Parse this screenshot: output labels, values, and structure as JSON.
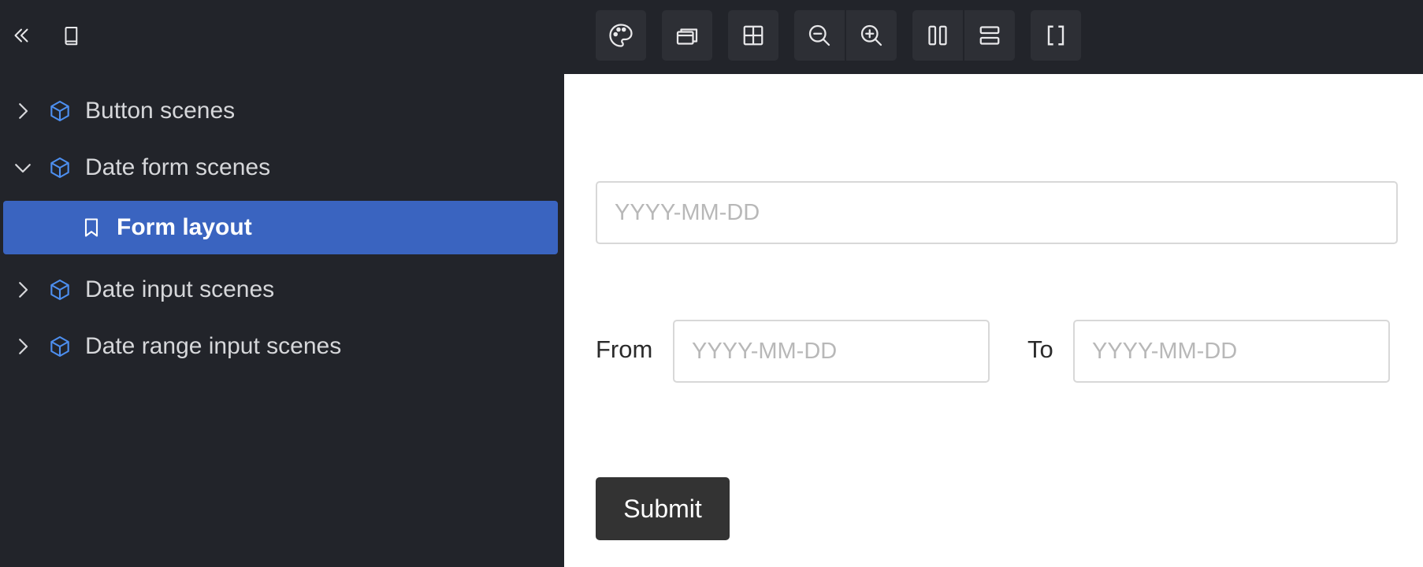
{
  "header": {
    "collapse_icon": "double-chevron-left-icon",
    "book_icon": "book-icon",
    "toolbar": [
      {
        "name": "palette-icon"
      },
      {
        "name": "layers-icon"
      },
      {
        "name": "grid-icon"
      },
      {
        "name": "zoom-out-icon"
      },
      {
        "name": "zoom-in-icon"
      },
      {
        "name": "split-vertical-icon"
      },
      {
        "name": "split-horizontal-icon"
      },
      {
        "name": "brackets-icon"
      }
    ]
  },
  "sidebar": {
    "items": [
      {
        "label": "Button scenes",
        "expanded": false
      },
      {
        "label": "Date form scenes",
        "expanded": true
      },
      {
        "label": "Form layout",
        "selected": true
      },
      {
        "label": "Date input scenes",
        "expanded": false
      },
      {
        "label": "Date range input scenes",
        "expanded": false
      }
    ]
  },
  "form": {
    "date_placeholder": "YYYY-MM-DD",
    "from_label": "From",
    "from_placeholder": "YYYY-MM-DD",
    "to_label": "To",
    "to_placeholder": "YYYY-MM-DD",
    "submit_label": "Submit"
  },
  "colors": {
    "sidebar_bg": "#22242a",
    "selected_bg": "#3a64c0",
    "cube_icon": "#4d8ff0",
    "submit_bg": "#333333"
  }
}
